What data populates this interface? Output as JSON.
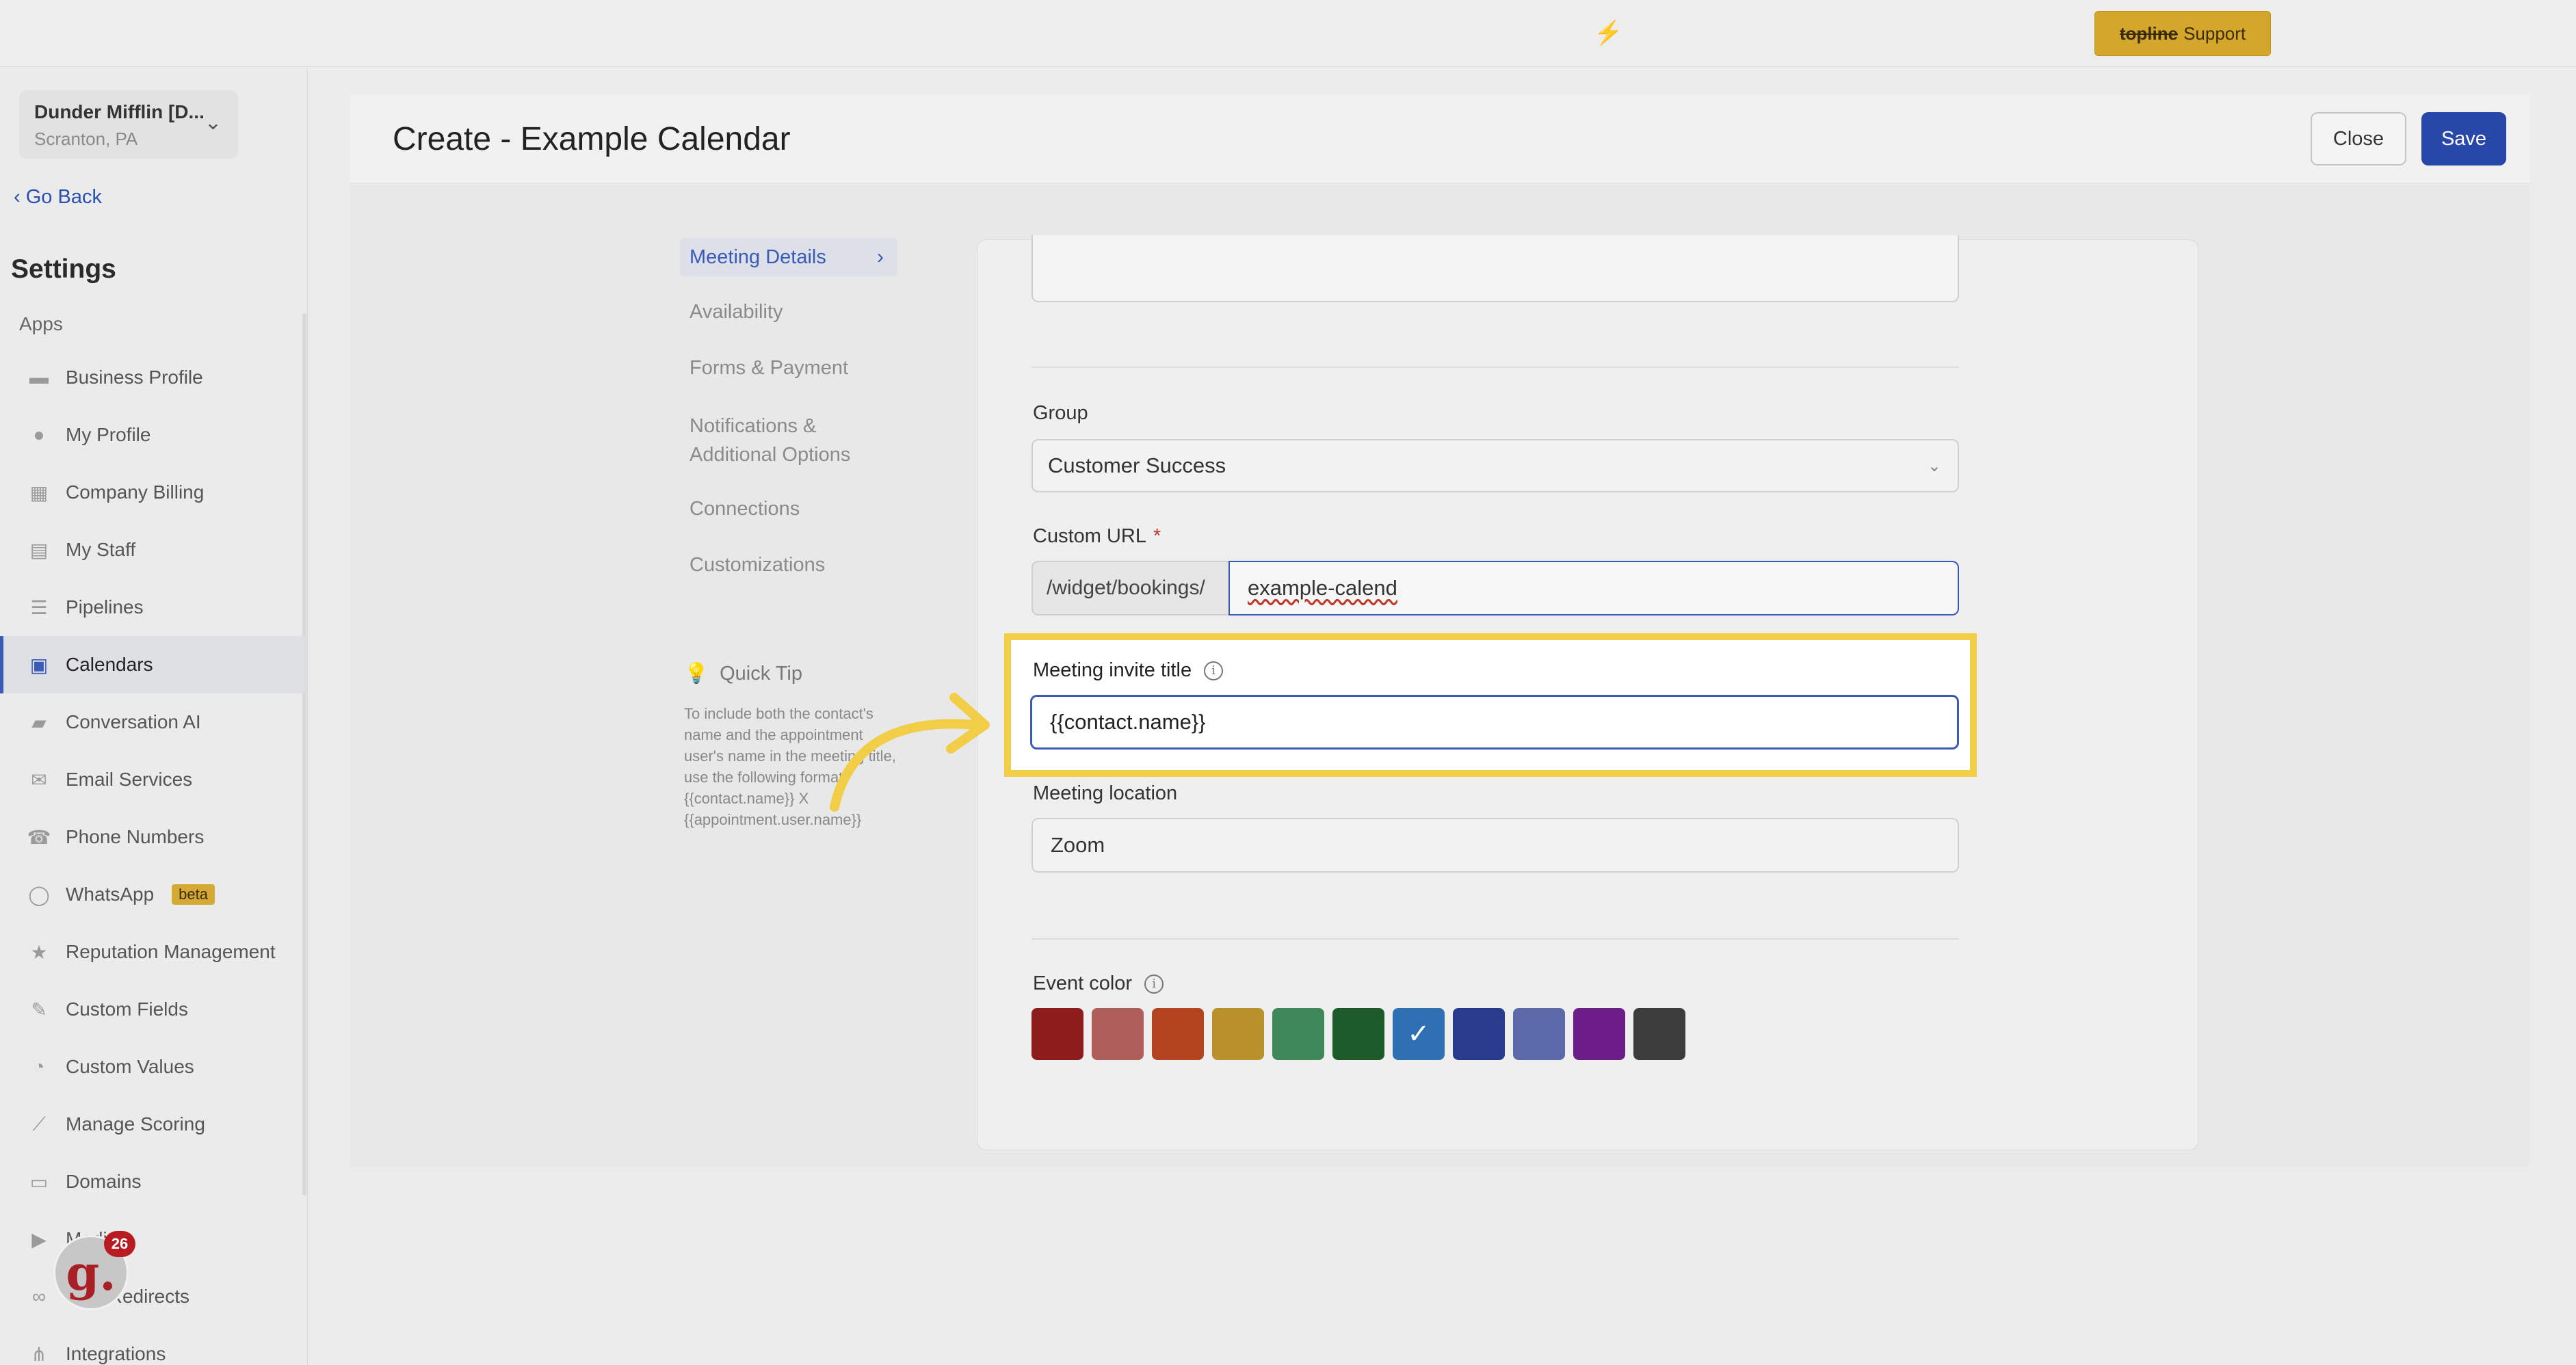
{
  "topbar": {
    "support_brand": "topline",
    "support_label": "Support"
  },
  "account": {
    "name": "Dunder Mifflin [D...",
    "location": "Scranton, PA"
  },
  "sidebar": {
    "go_back": "Go Back",
    "title": "Settings",
    "section": "Apps",
    "items": [
      {
        "label": "Business Profile",
        "icon": "briefcase-icon"
      },
      {
        "label": "My Profile",
        "icon": "person-icon"
      },
      {
        "label": "Company Billing",
        "icon": "grid-icon"
      },
      {
        "label": "My Staff",
        "icon": "inbox-icon"
      },
      {
        "label": "Pipelines",
        "icon": "funnel-icon"
      },
      {
        "label": "Calendars",
        "icon": "calendar-icon",
        "active": true
      },
      {
        "label": "Conversation AI",
        "icon": "chat-icon"
      },
      {
        "label": "Email Services",
        "icon": "mail-icon"
      },
      {
        "label": "Phone Numbers",
        "icon": "phone-icon"
      },
      {
        "label": "WhatsApp",
        "icon": "whatsapp-icon",
        "badge": "beta"
      },
      {
        "label": "Reputation Management",
        "icon": "star-icon"
      },
      {
        "label": "Custom Fields",
        "icon": "edit-icon"
      },
      {
        "label": "Custom Values",
        "icon": "pie-icon"
      },
      {
        "label": "Manage Scoring",
        "icon": "chart-icon"
      },
      {
        "label": "Domains",
        "icon": "server-icon"
      },
      {
        "label": "Media",
        "icon": "video-icon"
      },
      {
        "label": "URL Redirects",
        "icon": "link-icon"
      },
      {
        "label": "Integrations",
        "icon": "integration-icon"
      }
    ],
    "notification_count": "26"
  },
  "header": {
    "title": "Create - Example Calendar",
    "close_label": "Close",
    "save_label": "Save"
  },
  "subnav": {
    "items": [
      {
        "label": "Meeting Details",
        "active": true
      },
      {
        "label": "Availability"
      },
      {
        "label": "Forms & Payment"
      },
      {
        "label": "Notifications & Additional Options"
      },
      {
        "label": "Connections"
      },
      {
        "label": "Customizations"
      }
    ]
  },
  "quick_tip": {
    "title": "Quick Tip",
    "text": "To include both the contact's name and the appointment user's name in the meeting title, use the following format: {{contact.name}} X {{appointment.user.name}}"
  },
  "form": {
    "group_label": "Group",
    "group_value": "Customer Success",
    "custom_url_label": "Custom URL",
    "custom_url_required": "*",
    "custom_url_prefix": "/widget/bookings/",
    "custom_url_value": "example-calend",
    "invite_title_label": "Meeting invite title",
    "invite_title_value": "{{contact.name}}",
    "location_label": "Meeting location",
    "location_value": "Zoom",
    "event_color_label": "Event color",
    "event_colors": [
      "#8e1c1c",
      "#b05e5b",
      "#b3431f",
      "#b8912c",
      "#3e8758",
      "#1d5a2a",
      "#2f70b4",
      "#2a3a8d",
      "#5b69a8",
      "#6d1d88",
      "#3c3c3c"
    ],
    "selected_color_index": 6
  }
}
